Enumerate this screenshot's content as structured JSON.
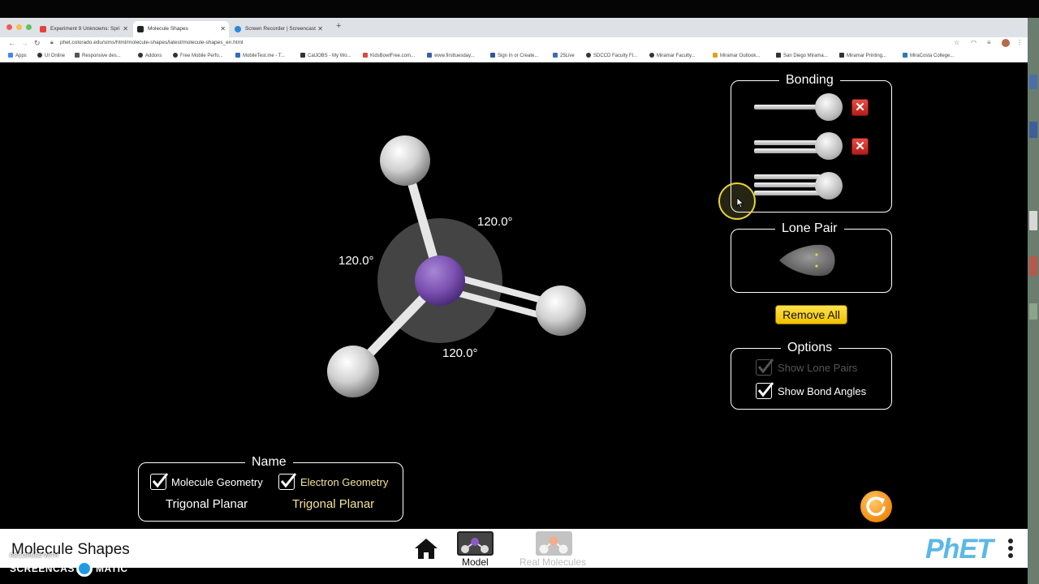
{
  "browser": {
    "tabs": [
      {
        "label": "Experiment 9 Unknowns: Spri",
        "color": "#e0453b"
      },
      {
        "label": "Molecule Shapes",
        "color": "#222222"
      },
      {
        "label": "Screen Recorder | Screencast",
        "color": "#2a8ad8"
      }
    ],
    "url": "phet.colorado.edu/sims/html/molecule-shapes/latest/molecule-shapes_en.html",
    "bookmarks": [
      {
        "label": "Apps",
        "color": "#4285f4"
      },
      {
        "label": "UI Online",
        "color": "#333333"
      },
      {
        "label": "Responsive des...",
        "color": "#555555"
      },
      {
        "label": "Addons",
        "color": "#333333"
      },
      {
        "label": "Free Mobile Perfo...",
        "color": "#333333"
      },
      {
        "label": "MobileTest.me - T...",
        "color": "#2e6fbb"
      },
      {
        "label": "CalJOBS - My Wo...",
        "color": "#333333"
      },
      {
        "label": "KidsBowlFree.com...",
        "color": "#d84a3a"
      },
      {
        "label": "www.firsttuesday...",
        "color": "#3b5fa8"
      },
      {
        "label": "Sign In or Create...",
        "color": "#2a5a9a"
      },
      {
        "label": "25Live",
        "color": "#3b6fb0"
      },
      {
        "label": "SDCCD Faculty Fl...",
        "color": "#333333"
      },
      {
        "label": "Miramar Faculty...",
        "color": "#333333"
      },
      {
        "label": "Miramar Outlook...",
        "color": "#e0a020"
      },
      {
        "label": "San Diego Mirama...",
        "color": "#333333"
      },
      {
        "label": "Miramar Printing...",
        "color": "#333333"
      },
      {
        "label": "MiraCosta College...",
        "color": "#2a7ab8"
      }
    ]
  },
  "bonding": {
    "title": "Bonding",
    "rows": [
      {
        "type": "single",
        "has_remove": true
      },
      {
        "type": "double",
        "has_remove": true
      },
      {
        "type": "triple",
        "has_remove": false
      }
    ]
  },
  "lone_pair": {
    "title": "Lone Pair"
  },
  "remove_all": {
    "label": "Remove All"
  },
  "options": {
    "title": "Options",
    "show_lone_pairs": {
      "label": "Show Lone Pairs",
      "checked": true,
      "enabled": false
    },
    "show_bond_angles": {
      "label": "Show Bond Angles",
      "checked": true,
      "enabled": true
    }
  },
  "molecule": {
    "angles": [
      "120.0°",
      "120.0°",
      "120.0°"
    ],
    "central_atom_color": "#7a4fb0"
  },
  "name_panel": {
    "title": "Name",
    "molecule_geometry": {
      "label": "Molecule Geometry",
      "value": "Trigonal Planar",
      "color": "#ffffff",
      "checked": true
    },
    "electron_geometry": {
      "label": "Electron Geometry",
      "value": "Trigonal Planar",
      "color": "#f4e39a",
      "checked": true
    }
  },
  "navbar": {
    "sim_title": "Molecule Shapes",
    "screens": [
      {
        "label": "Model",
        "active": true
      },
      {
        "label": "Real Molecules",
        "active": false
      }
    ],
    "logo": "PhET"
  },
  "watermark": {
    "small": "RECORDED WITH",
    "big": "SCREENCAST",
    "suffix": "MATIC"
  },
  "colors": {
    "accent_yellow": "#f2c100",
    "remove_red": "#d43a32",
    "reset_orange": "#f08a10",
    "phet_blue": "#5bb8e6"
  }
}
